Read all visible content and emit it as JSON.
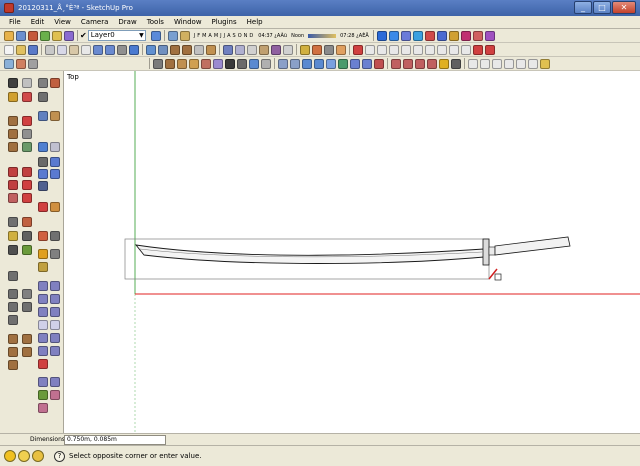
{
  "window": {
    "title": "20120311_Å¸°È³ª - SketchUp Pro",
    "minimize": "_",
    "maximize": "□",
    "close": "✕"
  },
  "menu": [
    "File",
    "Edit",
    "View",
    "Camera",
    "Draw",
    "Tools",
    "Window",
    "Plugins",
    "Help"
  ],
  "layer": {
    "check": "✔",
    "selected": "Layer0",
    "arrow": "▼"
  },
  "shadow": {
    "months": [
      "J",
      "F",
      "M",
      "A",
      "M",
      "J",
      "J",
      "A",
      "S",
      "O",
      "N",
      "D"
    ],
    "time_start": "04:37 ¿AÀü",
    "noon": "Noon",
    "time_end": "07:28 ¿AÈÄ"
  },
  "viewport": {
    "view_name": "Top"
  },
  "measurements": {
    "label": "Dimensions",
    "value": "0.750m, 0.085m"
  },
  "status": {
    "help": "?",
    "message": "Select opposite corner or enter value."
  },
  "colors": {
    "red_axis": "#e02020",
    "green_axis": "#2a9a2a",
    "sword_stroke": "#1a1a1a"
  }
}
